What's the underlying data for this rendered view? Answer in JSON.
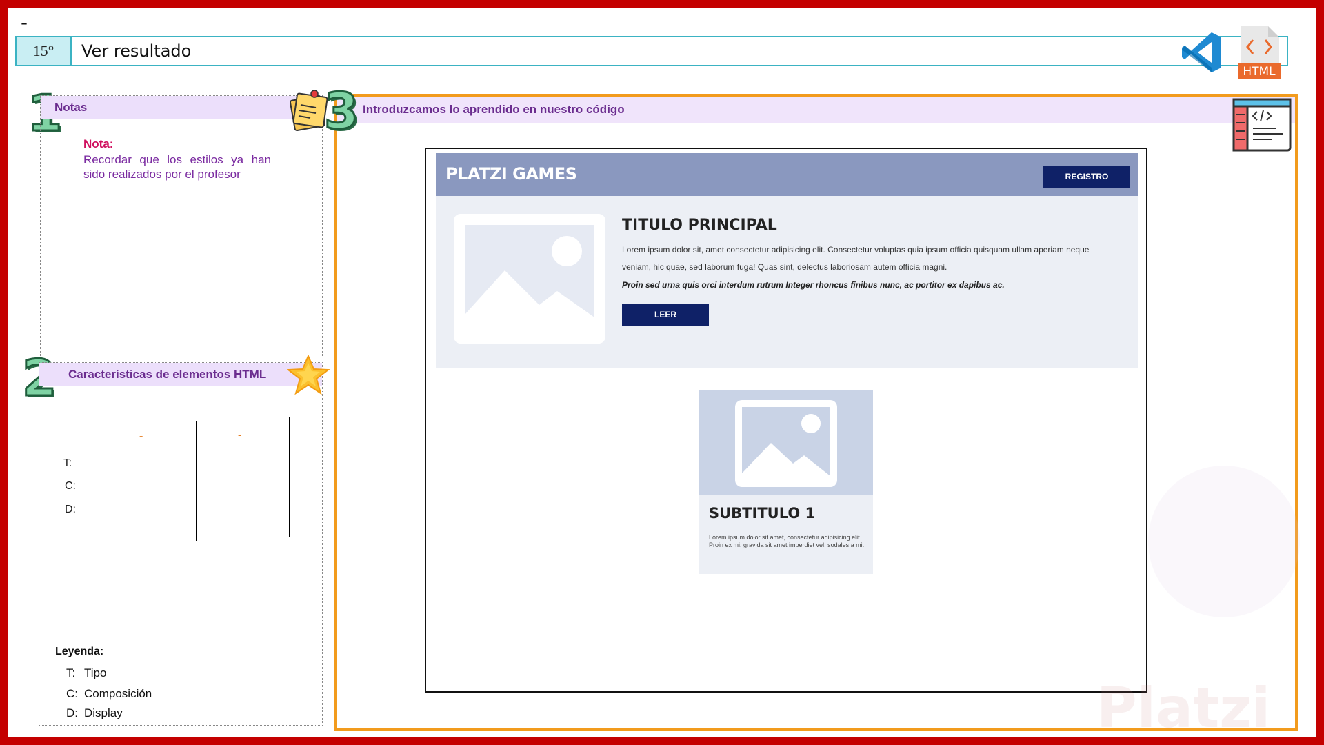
{
  "page": {
    "dash": "-",
    "header": {
      "number": "15°",
      "title": "Ver resultado",
      "icons": [
        "vscode-icon",
        "html-file-icon"
      ],
      "html_badge": "HTML"
    }
  },
  "notes": {
    "number": "1",
    "title": "Notas",
    "label": "Nota:",
    "text": "Recordar que los estilos ya han sido realizados por el profesor"
  },
  "characteristics": {
    "number": "2",
    "title": "Características de elementos HTML",
    "col_dash_1": "-",
    "col_dash_2": "-",
    "rows": [
      "T:",
      "C:",
      "D:"
    ],
    "legend_title": "Leyenda:",
    "legend": [
      {
        "key": "T:",
        "value": "Tipo"
      },
      {
        "key": "C:",
        "value": "Composición"
      },
      {
        "key": "D:",
        "value": "Display"
      }
    ]
  },
  "main": {
    "number": "3",
    "title": "Introduzcamos lo aprendido en nuestro código"
  },
  "site": {
    "logo": "PLATZI GAMES",
    "register_button": "REGISTRO",
    "hero_title": "TITULO PRINCIPAL",
    "hero_text": "Lorem ipsum dolor sit, amet consectetur adipisicing elit. Consectetur voluptas quia ipsum officia quisquam ullam aperiam neque veniam, hic quae, sed laborum fuga! Quas sint, delectus laboriosam autem officia magni.",
    "hero_text_bold": "Proin sed urna quis orci interdum rutrum Integer rhoncus finibus nunc, ac portitor ex dapibus ac.",
    "read_button": "LEER",
    "card_title": "SUBTITULO 1",
    "card_text": "Lorem ipsum dolor sit amet, consectetur adipisicing elit. Proin ex mi, gravida sit amet imperdiet vel, sodales a mi."
  },
  "watermark": "Platzi",
  "colors": {
    "frame": "#c40000",
    "accent_orange": "#f29b1d",
    "header_teal": "#3bb3c3",
    "panel_purple": "#ecdffb",
    "nav_blue": "#8a98bf",
    "button_navy": "#0f2167"
  }
}
